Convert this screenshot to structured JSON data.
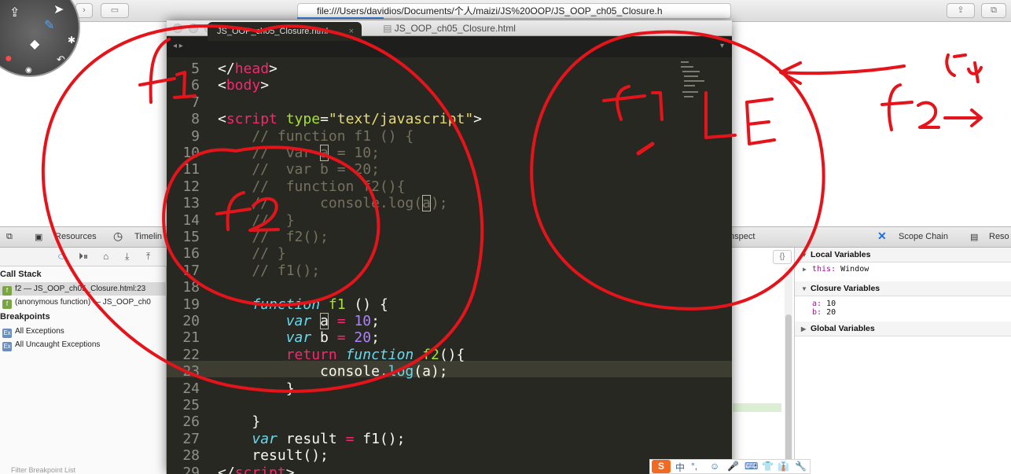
{
  "browser": {
    "url": "file:///Users/davidios/Documents/个人/maizi/JS%20OOP/JS_OOP_ch05_Closure.h"
  },
  "inspector": {
    "toolbar": {
      "resources": "Resources",
      "timeline": "Timelin",
      "inspect": "nspect",
      "scope_chain": "Scope Chain",
      "resources_right": "Reso"
    },
    "call_stack_title": "Call Stack",
    "call_stack": [
      {
        "label": "f2 — JS_OOP_ch05_Closure.html:23"
      },
      {
        "label": "(anonymous function) — JS_OOP_ch0"
      }
    ],
    "breakpoints_title": "Breakpoints",
    "breakpoints": [
      "All Exceptions",
      "All Uncaught Exceptions"
    ],
    "filter_placeholder": "Filter Breakpoint List",
    "braces_label": "{}",
    "scope": {
      "local_title": "Local Variables",
      "local_this_key": "this:",
      "local_this_val": "Window",
      "closure_title": "Closure Variables",
      "closure_a_key": "a:",
      "closure_a_val": "10",
      "closure_b_key": "b:",
      "closure_b_val": "20",
      "global_title": "Global Variables"
    }
  },
  "editor": {
    "window_title": "JS_OOP_ch05_Closure.html",
    "tab_label": "JS_OOP_ch05_Closure.html",
    "tab_close": "×",
    "line_numbers": [
      "5",
      "6",
      "7",
      "8",
      "9",
      "10",
      "11",
      "12",
      "13",
      "14",
      "15",
      "16",
      "17",
      "18",
      "19",
      "20",
      "21",
      "22",
      "23",
      "24",
      "25",
      "26",
      "27",
      "28",
      "29"
    ],
    "code": {
      "l5_a": "</",
      "l5_b": "head",
      "l5_c": ">",
      "l6_a": "<",
      "l6_b": "body",
      "l6_c": ">",
      "l8_a": "<",
      "l8_b": "script",
      "l8_c": " ",
      "l8_d": "type",
      "l8_e": "=",
      "l8_f": "\"text/javascript\"",
      "l8_g": ">",
      "l9": "    // function f1 () {",
      "l10_a": "    //  var ",
      "l10_b": "a",
      "l10_c": " = 10;",
      "l11": "    //  var b = 20;",
      "l12": "    //  function f2(){",
      "l13_a": "    //      console.log(",
      "l13_b": "a",
      "l13_c": ");",
      "l14": "    //  }",
      "l15": "    //  f2();",
      "l16": "    // }",
      "l17": "    // f1();",
      "l19_a": "    ",
      "l19_b": "function",
      "l19_c": " ",
      "l19_d": "f1",
      "l19_e": " () {",
      "l20_a": "        ",
      "l20_b": "var",
      "l20_c": " ",
      "l20_d": "a",
      "l20_e": " ",
      "l20_f": "=",
      "l20_g": " ",
      "l20_h": "10",
      "l20_i": ";",
      "l21_a": "        ",
      "l21_b": "var",
      "l21_c": " b ",
      "l21_d": "=",
      "l21_e": " ",
      "l21_f": "20",
      "l21_g": ";",
      "l22_a": "        ",
      "l22_b": "return",
      "l22_c": " ",
      "l22_d": "function",
      "l22_e": " ",
      "l22_f": "f2",
      "l22_g": "(){",
      "l23_a": "            console.",
      "l23_b": "log",
      "l23_c": "(a);",
      "l24": "        }",
      "l26": "    }",
      "l27_a": "    ",
      "l27_b": "var",
      "l27_c": " result ",
      "l27_d": "=",
      "l27_e": " f1();",
      "l28": "    result();",
      "l29_a": "</",
      "l29_b": "script",
      "l29_c": ">"
    }
  },
  "ime": {
    "sogou": "S",
    "lang": "中",
    "punct": "°,",
    "emoji": "☺",
    "mic": "🎤",
    "keyboard": "⌨",
    "skin": "👕",
    "shirt": "👔",
    "tool": "🔧"
  },
  "colors": {
    "editor_bg": "#272822",
    "annotation_red": "#e5141b"
  }
}
